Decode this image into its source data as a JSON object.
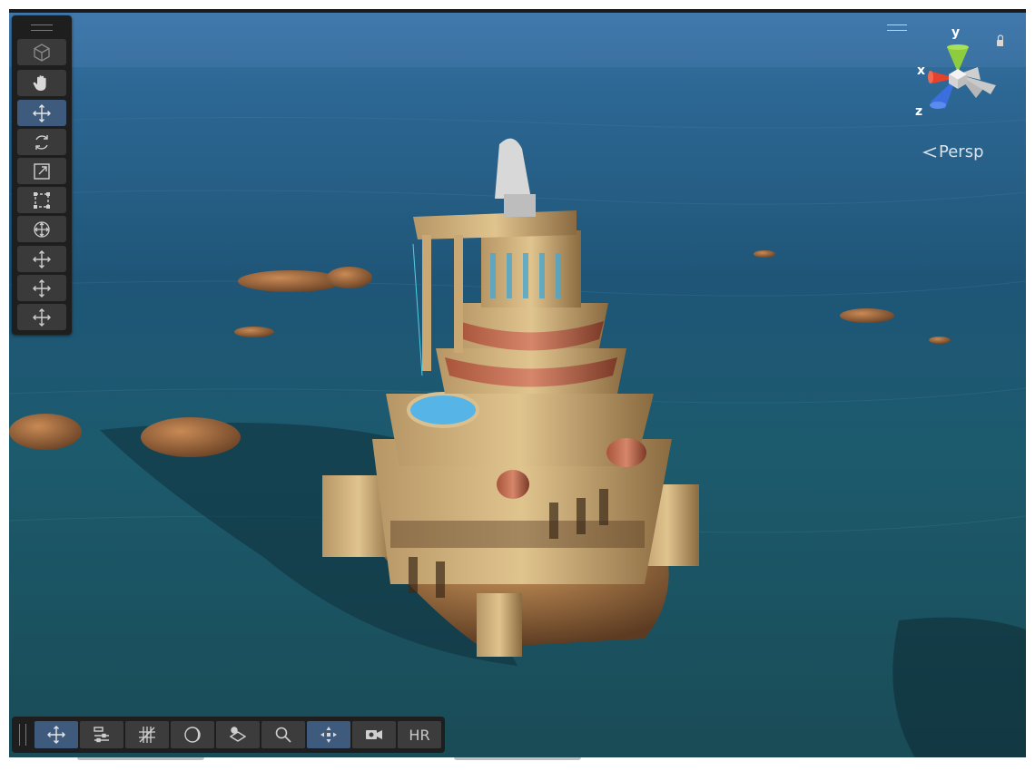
{
  "tools": [
    {
      "name": "view-mode",
      "icon": "cube-icon",
      "active": false
    },
    {
      "name": "view-tool",
      "icon": "hand-icon",
      "active": false
    },
    {
      "name": "move-tool",
      "icon": "move-arrows-icon",
      "active": true
    },
    {
      "name": "rotate-tool",
      "icon": "rotate-icon",
      "active": false
    },
    {
      "name": "scale-tool",
      "icon": "scale-icon",
      "active": false
    },
    {
      "name": "rect-tool",
      "icon": "rect-transform-icon",
      "active": false
    },
    {
      "name": "transform-tool",
      "icon": "transform-all-icon",
      "active": false
    },
    {
      "name": "custom-tool-1",
      "icon": "move-arrows-icon",
      "active": false
    },
    {
      "name": "custom-tool-2",
      "icon": "move-arrows-icon",
      "active": false
    },
    {
      "name": "custom-tool-3",
      "icon": "move-arrows-icon",
      "active": false
    }
  ],
  "overlay_toolbar": [
    {
      "name": "tool-settings",
      "icon": "move-arrows-icon",
      "active": true
    },
    {
      "name": "snap-settings",
      "icon": "sliders-icon",
      "active": false
    },
    {
      "name": "grid-settings",
      "icon": "grid-icon",
      "active": false
    },
    {
      "name": "draw-mode",
      "icon": "moon-shading-icon",
      "active": false
    },
    {
      "name": "layers",
      "icon": "layers-icon",
      "active": false
    },
    {
      "name": "search",
      "icon": "magnifier-icon",
      "active": false
    },
    {
      "name": "gizmos",
      "icon": "gizmo-icon",
      "active": true
    },
    {
      "name": "camera-visibility",
      "icon": "camera-eye-icon",
      "active": false
    },
    {
      "name": "hdr",
      "label": "HR",
      "active": false
    }
  ],
  "gizmo": {
    "x_label": "x",
    "y_label": "y",
    "z_label": "z",
    "x_color": "#e5422d",
    "y_color": "#8ccc3e",
    "z_color": "#3b6fe0",
    "projection_label": "Persp",
    "lock_icon": "lock-icon"
  }
}
